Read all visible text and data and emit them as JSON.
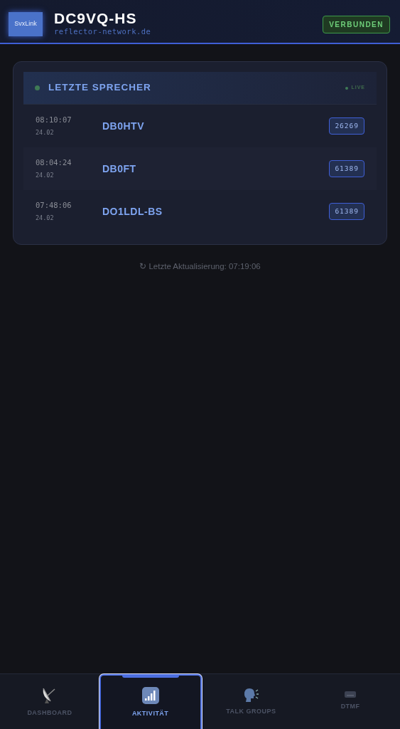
{
  "header": {
    "logo": "SvxLink",
    "title": "DC9VQ-HS",
    "subtitle": "reflector-network.de",
    "status": "VERBUNDEN",
    "connected": true
  },
  "panel": {
    "title": "LETZTE SPRECHER",
    "live": "LIVE",
    "rows": [
      {
        "time": "08:10:07",
        "date": "24.02",
        "callsign": "DB0HTV",
        "talkgroup": "26269"
      },
      {
        "time": "08:04:24",
        "date": "24.02",
        "callsign": "DB0FT",
        "talkgroup": "61389"
      },
      {
        "time": "07:48:06",
        "date": "24.02",
        "callsign": "DO1LDL-BS",
        "talkgroup": "61389"
      }
    ]
  },
  "last_update": "↻ Letzte Aktualisierung: 07:19:06",
  "tabs": [
    {
      "label": "DASHBOARD",
      "selected": false
    },
    {
      "label": "AKTIVITÄT",
      "selected": true
    },
    {
      "label": "TALK GROUPS",
      "selected": false
    },
    {
      "label": "DTMF",
      "selected": false
    }
  ]
}
